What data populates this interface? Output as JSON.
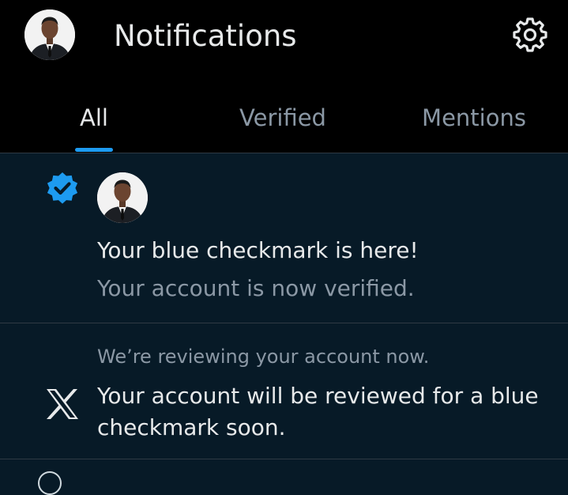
{
  "header": {
    "title": "Notifications",
    "avatar_icon": "profile-avatar",
    "settings_icon": "gear-icon"
  },
  "tabs": [
    {
      "label": "All",
      "active": true
    },
    {
      "label": "Verified",
      "active": false
    },
    {
      "label": "Mentions",
      "active": false
    }
  ],
  "notifications": [
    {
      "icon": "verified-badge-icon",
      "title": "Your blue checkmark is here!",
      "subtitle": "Your account is now verified."
    },
    {
      "icon": "x-logo-icon",
      "subtitle": "We’re reviewing your account now.",
      "body": "Your account will be reviewed for a blue checkmark soon."
    }
  ],
  "colors": {
    "accent": "#1d9bf0",
    "header_bg": "#000000",
    "list_bg": "#071a27",
    "text_primary": "#e7e9ea",
    "text_secondary": "#8b98a5",
    "divider": "#2f3a44"
  }
}
